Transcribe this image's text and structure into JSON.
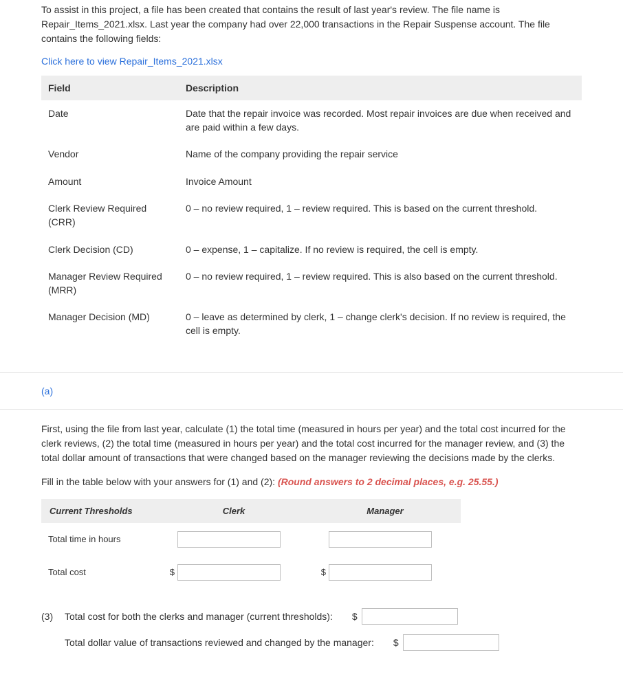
{
  "intro": "To assist in this project, a file has been created that contains the result of last year's review. The file name is Repair_Items_2021.xlsx. Last year the company had over 22,000 transactions in the Repair Suspense account. The file contains the following fields:",
  "file_link": "Click here to view Repair_Items_2021.xlsx",
  "fields_table": {
    "headers": {
      "field": "Field",
      "description": "Description"
    },
    "rows": [
      {
        "field": "Date",
        "desc": "Date that the repair invoice was recorded. Most repair invoices are due when received and are paid within a few days."
      },
      {
        "field": "Vendor",
        "desc": "Name of the company providing the repair service"
      },
      {
        "field": "Amount",
        "desc": "Invoice Amount"
      },
      {
        "field": "Clerk Review Required (CRR)",
        "desc": "0 – no review required, 1 – review required. This is based on the current threshold."
      },
      {
        "field": "Clerk Decision (CD)",
        "desc": "0 – expense, 1 – capitalize. If no review is required, the cell is empty."
      },
      {
        "field": "Manager Review Required (MRR)",
        "desc": "0 – no review required, 1 – review required. This is also based on the current threshold."
      },
      {
        "field": "Manager Decision (MD)",
        "desc": "0 – leave as determined by clerk, 1 – change clerk's decision. If no review is required, the cell is empty."
      }
    ]
  },
  "part_label": "(a)",
  "instructions": "First, using the file from last year, calculate (1) the total time (measured in hours per year) and the total cost incurred for the clerk reviews, (2) the total time (measured in hours per year) and the total cost incurred for the manager review, and (3) the total dollar amount of transactions that were changed based on the manager reviewing the decisions made by the clerks.",
  "fill_prompt_prefix": "Fill in the table below with your answers for (1) and (2): ",
  "fill_prompt_hint": "(Round answers to 2 decimal places, e.g. 25.55.)",
  "answers_table": {
    "headers": {
      "col0": "Current Thresholds",
      "col1": "Clerk",
      "col2": "Manager"
    },
    "rows": {
      "r1": "Total time in hours",
      "r2": "Total cost"
    },
    "currency": "$"
  },
  "q3": {
    "num": "(3)",
    "line1": "Total cost for both the clerks and manager (current thresholds):",
    "line2": "Total dollar value of transactions reviewed and changed by the manager:",
    "currency": "$"
  }
}
